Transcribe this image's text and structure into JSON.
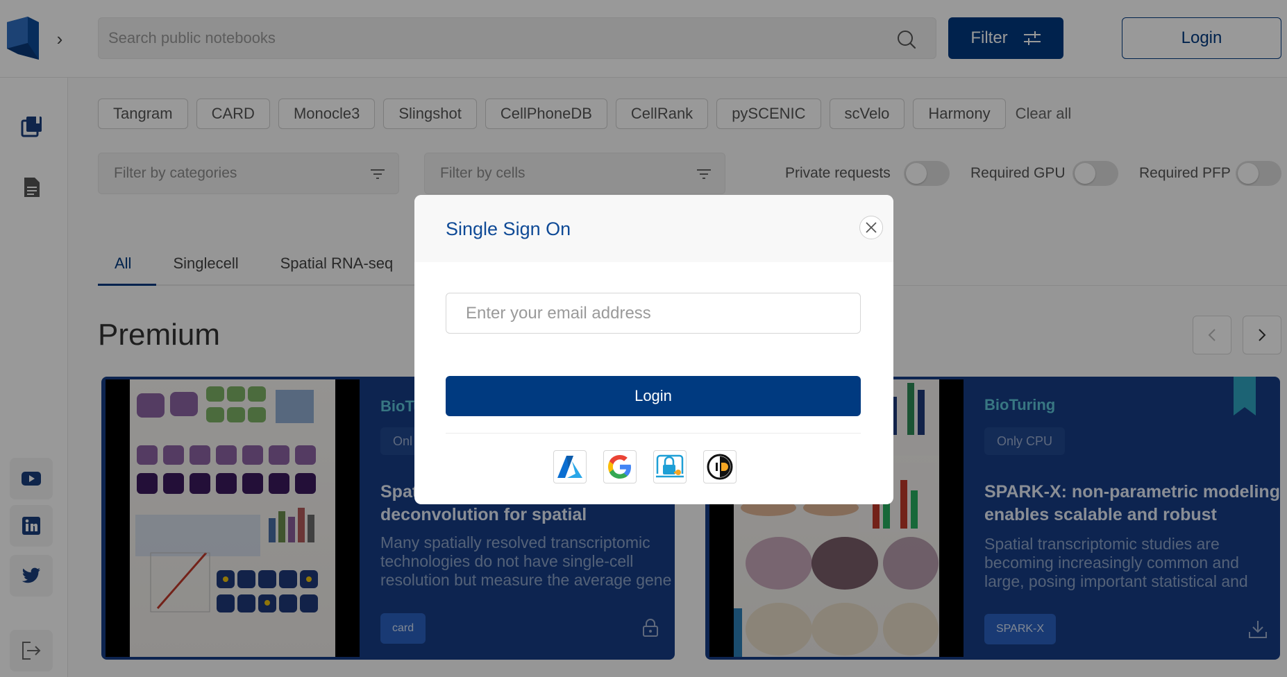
{
  "header": {
    "search_placeholder": "Search public notebooks",
    "filter_label": "Filter",
    "login_label": "Login"
  },
  "chips": [
    "Tangram",
    "CARD",
    "Monocle3",
    "Slingshot",
    "CellPhoneDB",
    "CellRank",
    "pySCENIC",
    "scVelo",
    "Harmony"
  ],
  "clear_all": "Clear all",
  "filters": {
    "categories_placeholder": "Filter by categories",
    "cells_placeholder": "Filter by cells",
    "private_requests": "Private requests",
    "required_gpu": "Required GPU",
    "required_pfp": "Required PFP"
  },
  "tabs": [
    "All",
    "Singlecell",
    "Spatial RNA-seq"
  ],
  "section_title": "Premium",
  "cards": [
    {
      "brand": "BioTu",
      "badge": "Onl",
      "title_line1": "Spat",
      "title_line2": "deconvolution for spatial",
      "desc_line1": "Many spatially resolved transcriptomic",
      "desc_line2": "technologies do not have single-cell",
      "desc_line3": "resolution but measure the average gene",
      "tag": "card"
    },
    {
      "brand": "BioTuring",
      "badge": "Only CPU",
      "title_line1": "SPARK-X: non-parametric modeling",
      "title_line2": "enables scalable and robust",
      "desc_line1": "Spatial transcriptomic studies are",
      "desc_line2": "becoming increasingly common and",
      "desc_line3": "large, posing important statistical and",
      "tag": "SPARK-X"
    }
  ],
  "modal": {
    "title": "Single Sign On",
    "email_placeholder": "Enter your email address",
    "login_label": "Login",
    "providers": [
      "azure-icon",
      "google-icon",
      "lock-key-icon",
      "orcid-icon"
    ]
  },
  "colors": {
    "primary": "#003a80",
    "card_bg": "#173d86",
    "brand_teal": "#5ec6d9",
    "bookmark": "#2fa6c2"
  }
}
